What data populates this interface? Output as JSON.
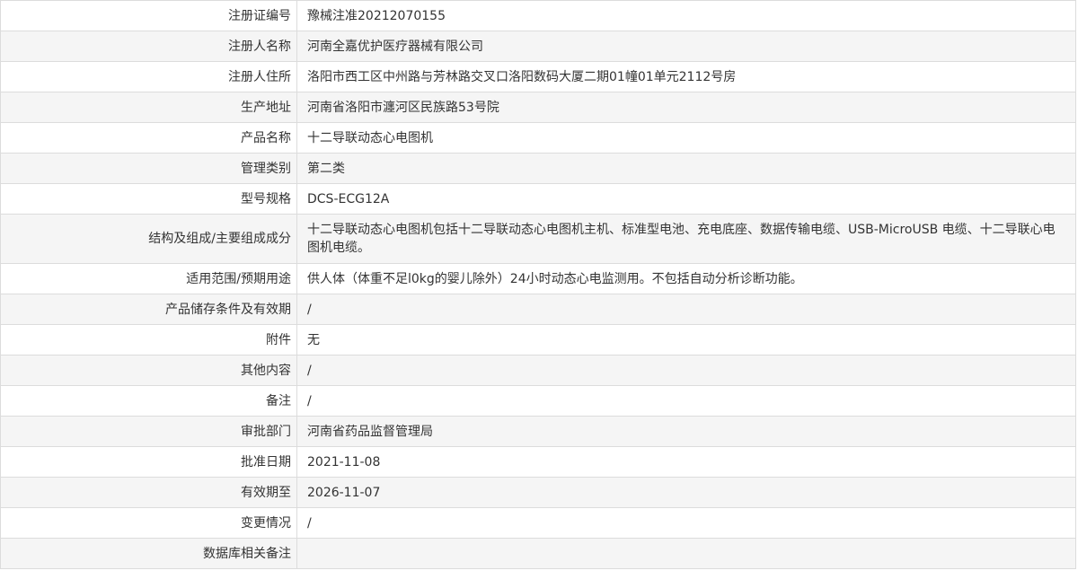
{
  "record": {
    "rows": [
      {
        "label": "注册证编号",
        "value": "豫械注准20212070155"
      },
      {
        "label": "注册人名称",
        "value": "河南全嘉优护医疗器械有限公司"
      },
      {
        "label": "注册人住所",
        "value": "洛阳市西工区中州路与芳林路交叉口洛阳数码大厦二期01幢01单元2112号房"
      },
      {
        "label": "生产地址",
        "value": "河南省洛阳市瀍河区民族路53号院"
      },
      {
        "label": "产品名称",
        "value": "十二导联动态心电图机"
      },
      {
        "label": "管理类别",
        "value": "第二类"
      },
      {
        "label": "型号规格",
        "value": "DCS-ECG12A"
      },
      {
        "label": "结构及组成/主要组成成分",
        "value": "十二导联动态心电图机包括十二导联动态心电图机主机、标准型电池、充电底座、数据传输电缆、USB-MicroUSB 电缆、十二导联心电图机电缆。"
      },
      {
        "label": "适用范围/预期用途",
        "value": "供人体（体重不足l0kg的婴儿除外）24小时动态心电监测用。不包括自动分析诊断功能。"
      },
      {
        "label": "产品储存条件及有效期",
        "value": "/"
      },
      {
        "label": "附件",
        "value": "无"
      },
      {
        "label": "其他内容",
        "value": "/"
      },
      {
        "label": "备注",
        "value": "/"
      },
      {
        "label": "审批部门",
        "value": "河南省药品监督管理局"
      },
      {
        "label": "批准日期",
        "value": "2021-11-08"
      },
      {
        "label": "有效期至",
        "value": "2026-11-07"
      },
      {
        "label": "变更情况",
        "value": "/"
      },
      {
        "label": "数据库相关备注",
        "value": ""
      }
    ]
  }
}
